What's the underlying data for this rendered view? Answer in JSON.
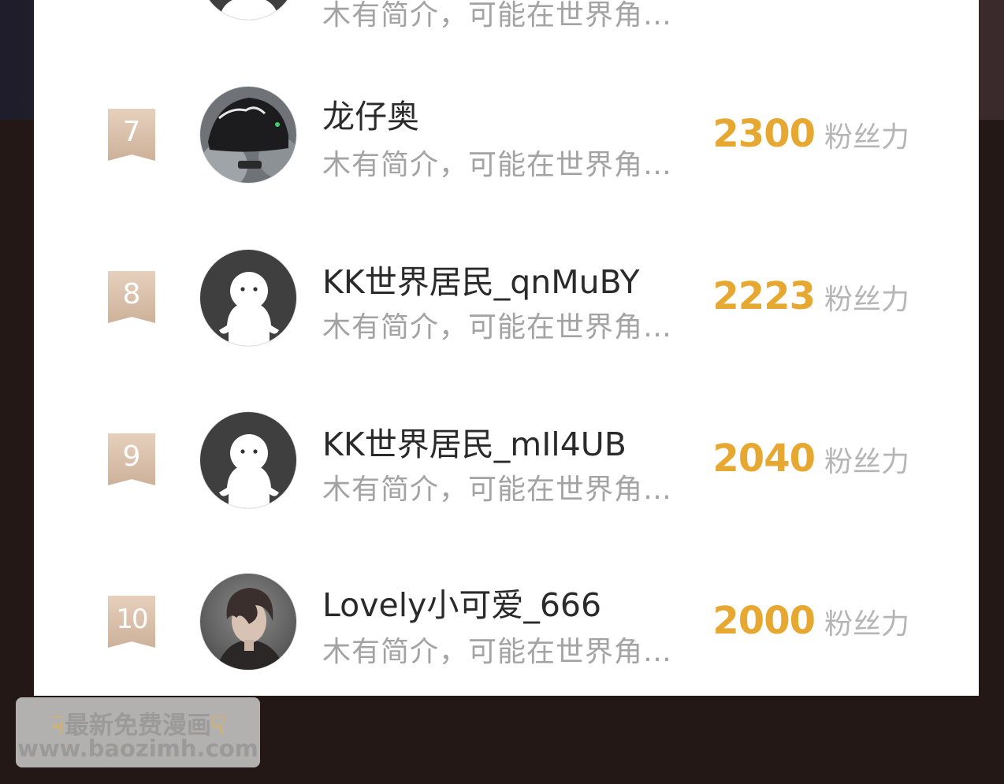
{
  "partial_top_row": {
    "bio": "木有简介，可能在世界角…"
  },
  "leaderboard": [
    {
      "rank": "7",
      "name": "龙仔奥",
      "bio": "木有简介，可能在世界角…",
      "score": "2300",
      "unit": "粉丝力",
      "avatar": "cap-photo-avatar"
    },
    {
      "rank": "8",
      "name": "KK世界居民_qnMuBY",
      "bio": "木有简介，可能在世界角…",
      "score": "2223",
      "unit": "粉丝力",
      "avatar": "default-ghost-avatar"
    },
    {
      "rank": "9",
      "name": "KK世界居民_mIl4UB",
      "bio": "木有简介，可能在世界角…",
      "score": "2040",
      "unit": "粉丝力",
      "avatar": "default-ghost-avatar"
    },
    {
      "rank": "10",
      "name": "Lovely小可爱_666",
      "bio": "木有简介，可能在世界角…",
      "score": "2000",
      "unit": "粉丝力",
      "avatar": "anime-boy-avatar"
    }
  ],
  "watermark": {
    "line1": "最新免费漫画",
    "line2": "www.baozimh.com",
    "icon": "pointing-down-hand-icon"
  },
  "colors": {
    "score": "#e7a832",
    "badge": "#d8bda6",
    "bio": "#a3a3a3"
  }
}
